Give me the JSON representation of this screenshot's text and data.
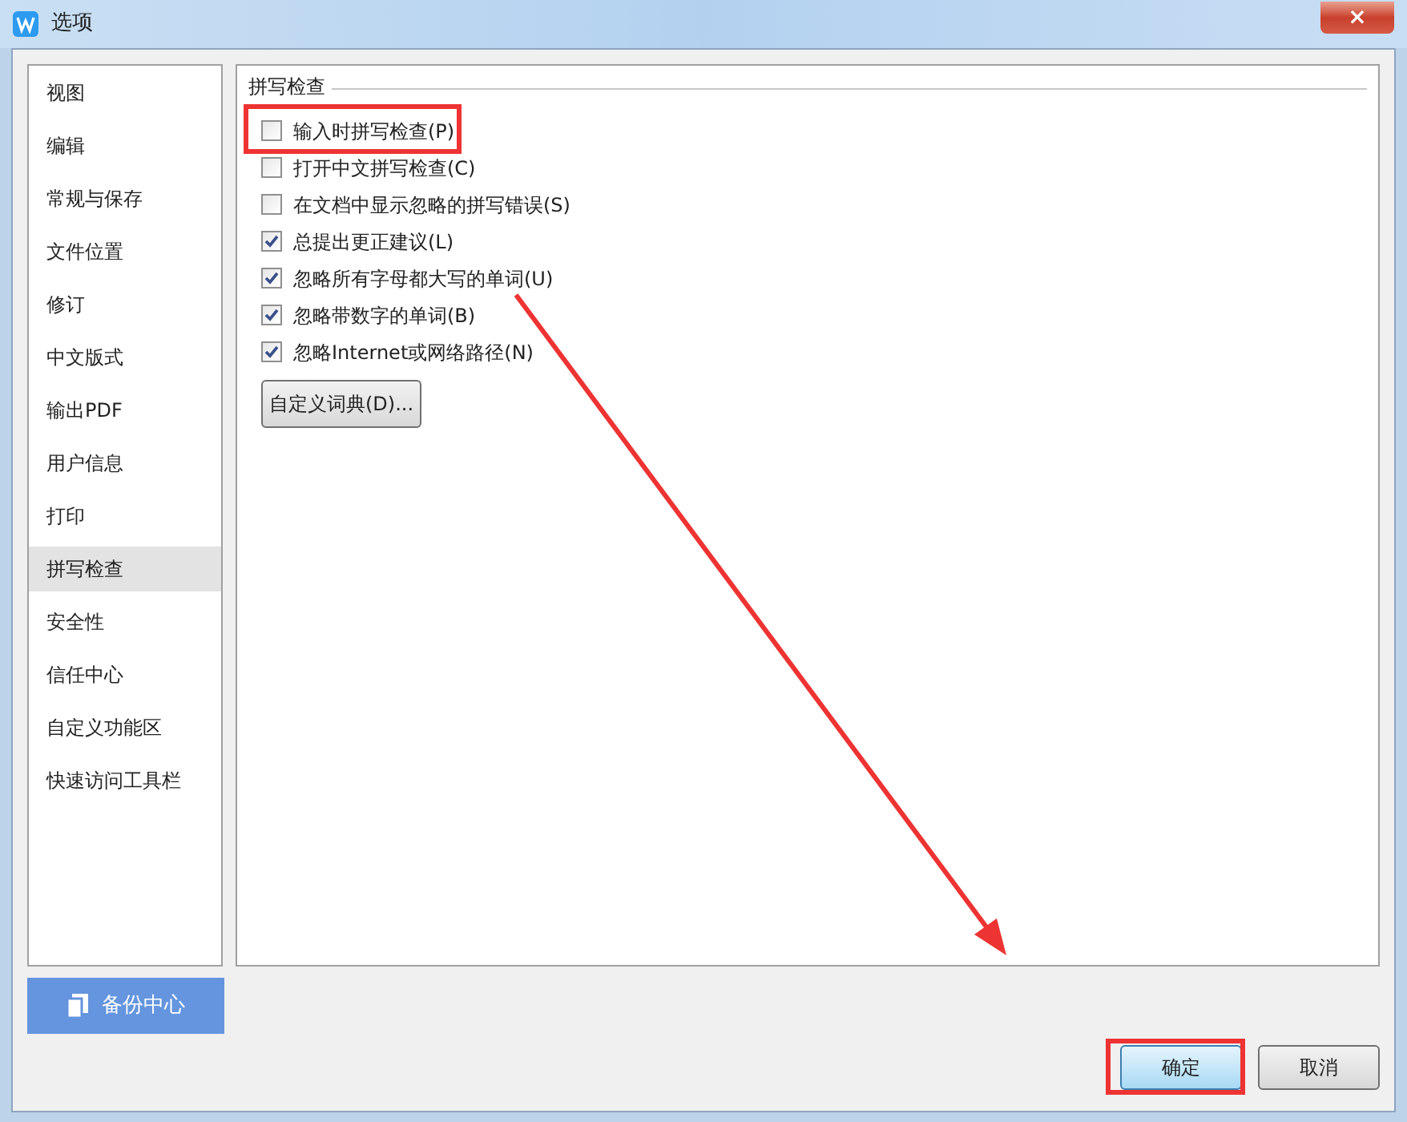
{
  "window": {
    "title": "选项",
    "close": "×"
  },
  "sidebar": {
    "items": [
      {
        "label": "视图",
        "selected": false
      },
      {
        "label": "编辑",
        "selected": false
      },
      {
        "label": "常规与保存",
        "selected": false
      },
      {
        "label": "文件位置",
        "selected": false
      },
      {
        "label": "修订",
        "selected": false
      },
      {
        "label": "中文版式",
        "selected": false
      },
      {
        "label": "输出PDF",
        "selected": false
      },
      {
        "label": "用户信息",
        "selected": false
      },
      {
        "label": "打印",
        "selected": false
      },
      {
        "label": "拼写检查",
        "selected": true
      },
      {
        "label": "安全性",
        "selected": false
      },
      {
        "label": "信任中心",
        "selected": false
      },
      {
        "label": "自定义功能区",
        "selected": false
      },
      {
        "label": "快速访问工具栏",
        "selected": false
      }
    ]
  },
  "backup_button": "备份中心",
  "group": {
    "title": "拼写检查",
    "options": [
      {
        "label": "输入时拼写检查(P)",
        "checked": false
      },
      {
        "label": "打开中文拼写检查(C)",
        "checked": false
      },
      {
        "label": "在文档中显示忽略的拼写错误(S)",
        "checked": false
      },
      {
        "label": "总提出更正建议(L)",
        "checked": true
      },
      {
        "label": "忽略所有字母都大写的单词(U)",
        "checked": true
      },
      {
        "label": "忽略带数字的单词(B)",
        "checked": true
      },
      {
        "label": "忽略Internet或网络路径(N)",
        "checked": true
      }
    ],
    "dictionary_button": "自定义词典(D)..."
  },
  "buttons": [
    {
      "label": "确定",
      "kind": "primary"
    },
    {
      "label": "取消",
      "kind": "normal"
    }
  ]
}
